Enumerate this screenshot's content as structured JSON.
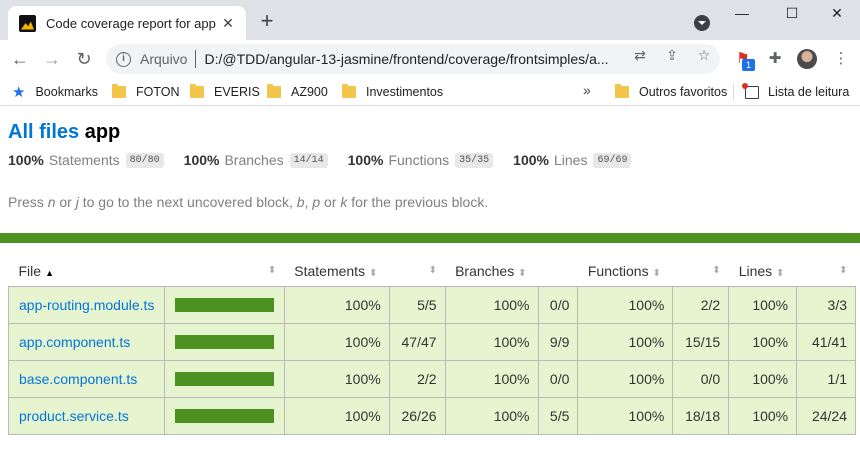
{
  "browser": {
    "tab_title": "Code coverage report for app",
    "tab_close": "✕",
    "newtab": "+",
    "minimize": "—",
    "maximize": "☐",
    "close": "✕",
    "back": "←",
    "forward": "→",
    "reload": "↻",
    "scheme_label": "Arquivo",
    "url": "D:/@TDD/angular-13-jasmine/frontend/coverage/frontsimples/a...",
    "menu": "⋮",
    "bookmarks": [
      "Bookmarks",
      "FOTON",
      "EVERIS",
      "AZ900",
      "Investimentos"
    ],
    "more_bookmarks": "»",
    "other_favorites": "Outros favoritos",
    "reading_list": "Lista de leitura",
    "extension_badge": "1"
  },
  "report": {
    "title_link": "All files",
    "title_dir": "app",
    "summary": [
      {
        "pct": "100%",
        "label": "Statements",
        "fraction": "80/80"
      },
      {
        "pct": "100%",
        "label": "Branches",
        "fraction": "14/14"
      },
      {
        "pct": "100%",
        "label": "Functions",
        "fraction": "35/35"
      },
      {
        "pct": "100%",
        "label": "Lines",
        "fraction": "69/69"
      }
    ],
    "hint": {
      "t1": "Press ",
      "k1": "n",
      "t2": " or ",
      "k2": "j",
      "t3": " to go to the next uncovered block, ",
      "k3": "b",
      "t4": ", ",
      "k4": "p",
      "t5": " or ",
      "k5": "k",
      "t6": " for the previous block."
    },
    "columns": [
      "File",
      "Statements",
      "Branches",
      "Functions",
      "Lines"
    ],
    "sort_glyph": "⬍",
    "asc_glyph": "▲",
    "rows": [
      {
        "file": "app-routing.module.ts",
        "coverage": 1.0,
        "st_pct": "100%",
        "st": "5/5",
        "br_pct": "100%",
        "br": "0/0",
        "fn_pct": "100%",
        "fn": "2/2",
        "ln_pct": "100%",
        "ln": "3/3"
      },
      {
        "file": "app.component.ts",
        "coverage": 1.0,
        "st_pct": "100%",
        "st": "47/47",
        "br_pct": "100%",
        "br": "9/9",
        "fn_pct": "100%",
        "fn": "15/15",
        "ln_pct": "100%",
        "ln": "41/41"
      },
      {
        "file": "base.component.ts",
        "coverage": 1.0,
        "st_pct": "100%",
        "st": "2/2",
        "br_pct": "100%",
        "br": "0/0",
        "fn_pct": "100%",
        "fn": "0/0",
        "ln_pct": "100%",
        "ln": "1/1"
      },
      {
        "file": "product.service.ts",
        "coverage": 1.0,
        "st_pct": "100%",
        "st": "26/26",
        "br_pct": "100%",
        "br": "5/5",
        "fn_pct": "100%",
        "fn": "18/18",
        "ln_pct": "100%",
        "ln": "24/24"
      }
    ]
  }
}
